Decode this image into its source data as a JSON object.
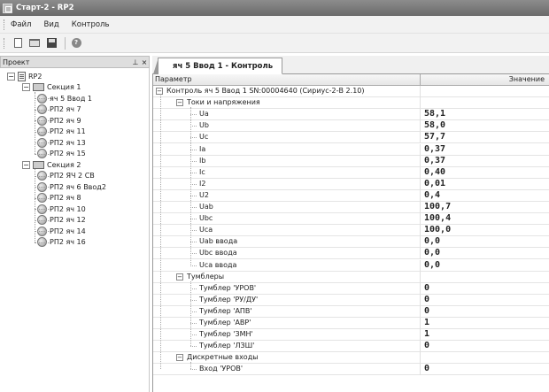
{
  "window": {
    "title": "Старт-2 - RP2"
  },
  "menu": {
    "items": [
      "Файл",
      "Вид",
      "Контроль"
    ]
  },
  "toolbar": {
    "buttons": [
      "new-icon",
      "open-icon",
      "save-icon",
      "help-icon"
    ]
  },
  "project_panel": {
    "title": "Проект",
    "pin": "₽",
    "close": "×",
    "root": "RP2",
    "sections": [
      {
        "label": "Секция 1",
        "items": [
          "яч 5 Ввод 1",
          "РП2 яч 7",
          "РП2 яч 9",
          "РП2 яч 11",
          "РП2 яч 13",
          "РП2 яч 15"
        ]
      },
      {
        "label": "Секция 2",
        "items": [
          "РП2 ЯЧ 2 СВ",
          "РП2 яч 6 Ввод2",
          "РП2 яч 8",
          "РП2 яч 10",
          "РП2 яч 12",
          "РП2 яч 14",
          "РП2 яч 16"
        ]
      }
    ]
  },
  "tab": {
    "label": "яч 5 Ввод 1 - Контроль"
  },
  "grid": {
    "col_param": "Параметр",
    "col_value": "Значение",
    "device": "Контроль яч 5 Ввод 1 SN:00004640 (Сириус-2-В 2.10)",
    "groups": [
      {
        "label": "Токи и напряжения",
        "rows": [
          [
            "Ua",
            "58,1"
          ],
          [
            "Ub",
            "58,0"
          ],
          [
            "Uc",
            "57,7"
          ],
          [
            "Ia",
            "0,37"
          ],
          [
            "Ib",
            "0,37"
          ],
          [
            "Ic",
            "0,40"
          ],
          [
            "I2",
            "0,01"
          ],
          [
            "U2",
            "0,4"
          ],
          [
            "Uab",
            "100,7"
          ],
          [
            "Ubc",
            "100,4"
          ],
          [
            "Uca",
            "100,0"
          ],
          [
            "Uab ввода",
            "0,0"
          ],
          [
            "Ubc ввода",
            "0,0"
          ],
          [
            "Uca ввода",
            "0,0"
          ]
        ]
      },
      {
        "label": "Тумблеры",
        "rows": [
          [
            "Тумблер 'УРОВ'",
            "0"
          ],
          [
            "Тумблер 'РУ/ДУ'",
            "0"
          ],
          [
            "Тумблер 'АПВ'",
            "0"
          ],
          [
            "Тумблер 'АВР'",
            "1"
          ],
          [
            "Тумблер 'ЗМН'",
            "1"
          ],
          [
            "Тумблер 'ЛЗШ'",
            "0"
          ]
        ]
      },
      {
        "label": "Дискретные входы",
        "rows": [
          [
            "Вход 'УРОВ'",
            "0"
          ]
        ]
      }
    ]
  }
}
